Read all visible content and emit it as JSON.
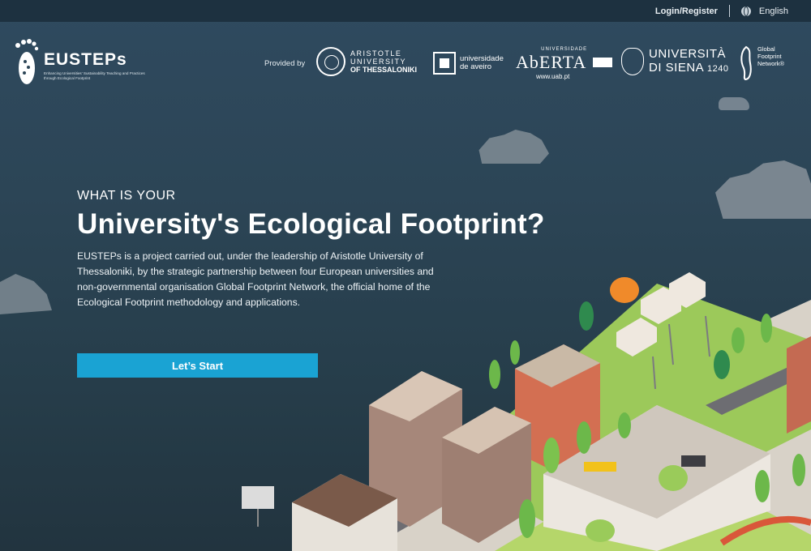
{
  "topbar": {
    "login_label": "Login/Register",
    "language": "English",
    "bg": "#1d3140"
  },
  "brand": {
    "name": "EUSTEPs",
    "subtitle": "Enhancing Universities' Sustainability Teaching and Practices through Ecological Footprint",
    "icon": "footprint-icon"
  },
  "partners": {
    "provided_label": "Provided by",
    "auth": {
      "line1": "ARISTOTLE",
      "line2": "UNIVERSITY",
      "line3": "OF THESSALONIKI"
    },
    "aveiro": {
      "line1": "universidade",
      "line2": "de aveiro"
    },
    "aberta": {
      "top": "UNIVERSIDADE",
      "name": "AbERTA",
      "url": "www.uab.pt"
    },
    "siena": {
      "line1": "UNIVERSITÀ",
      "line2": "DI SIENA",
      "year": "1240"
    },
    "gfn": {
      "line1": "Global",
      "line2": "Footprint",
      "line3": "Network®"
    }
  },
  "hero": {
    "eyebrow": "WHAT IS YOUR",
    "title": "University's Ecological Footprint?",
    "description": "EUSTEPs is a project carried out, under the leadership of Aristotle University of Thessaloniki, by the strategic partnership between four European universities and non-governmental organisation Global Footprint Network, the official home of the Ecological Footprint methodology and applications.",
    "cta_label": "Let’s Start",
    "cta_color": "#1aa3d3"
  },
  "colors": {
    "background": "#2c4556",
    "accent": "#1aa3d3"
  }
}
